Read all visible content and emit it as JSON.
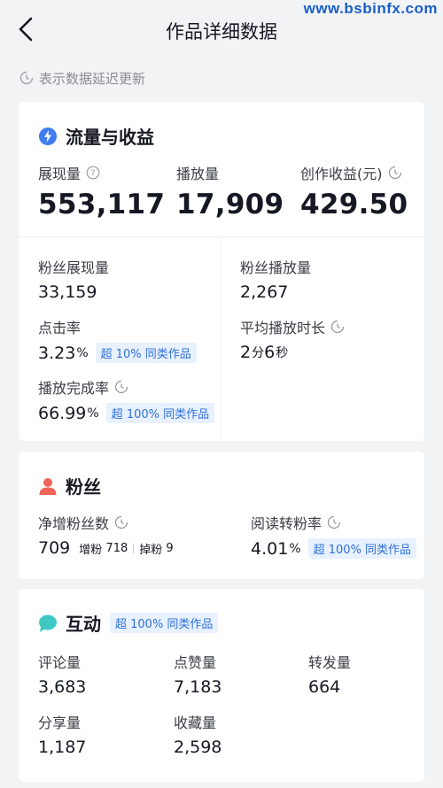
{
  "watermark": "www.bsbinfx.com",
  "header": {
    "title": "作品详细数据"
  },
  "notice": {
    "text": "表示数据延迟更新"
  },
  "traffic": {
    "title": "流量与收益",
    "impressions": {
      "label": "展现量",
      "value": "553,117"
    },
    "plays": {
      "label": "播放量",
      "value": "17,909"
    },
    "earnings": {
      "label": "创作收益(元)",
      "value": "429.50"
    },
    "fan_impressions": {
      "label": "粉丝展现量",
      "value": "33,159"
    },
    "fan_plays": {
      "label": "粉丝播放量",
      "value": "2,267"
    },
    "ctr": {
      "label": "点击率",
      "value": "3.23",
      "unit": "%",
      "badge": "超 10% 同类作品"
    },
    "avg_duration": {
      "label": "平均播放时长",
      "min": "2",
      "min_unit": "分",
      "sec": "6",
      "sec_unit": "秒"
    },
    "completion": {
      "label": "播放完成率",
      "value": "66.99",
      "unit": "%",
      "badge": "超 100% 同类作品"
    }
  },
  "fans": {
    "title": "粉丝",
    "net": {
      "label": "净增粉丝数",
      "value": "709",
      "gain_label": "增粉",
      "gain": "718",
      "loss_label": "掉粉",
      "loss": "9"
    },
    "conversion": {
      "label": "阅读转粉率",
      "value": "4.01",
      "unit": "%",
      "badge": "超 100% 同类作品"
    }
  },
  "interaction": {
    "title": "互动",
    "badge": "超 100% 同类作品",
    "comments": {
      "label": "评论量",
      "value": "3,683"
    },
    "likes": {
      "label": "点赞量",
      "value": "7,183"
    },
    "shares": {
      "label": "转发量",
      "value": "664"
    },
    "shares_out": {
      "label": "分享量",
      "value": "1,187"
    },
    "favorites": {
      "label": "收藏量",
      "value": "2,598"
    }
  },
  "colors": {
    "accent": "#2e6fd8",
    "badge_bg": "#e8f1ff",
    "fan_icon": "#f0655a",
    "chat_icon": "#3fc7c4"
  }
}
